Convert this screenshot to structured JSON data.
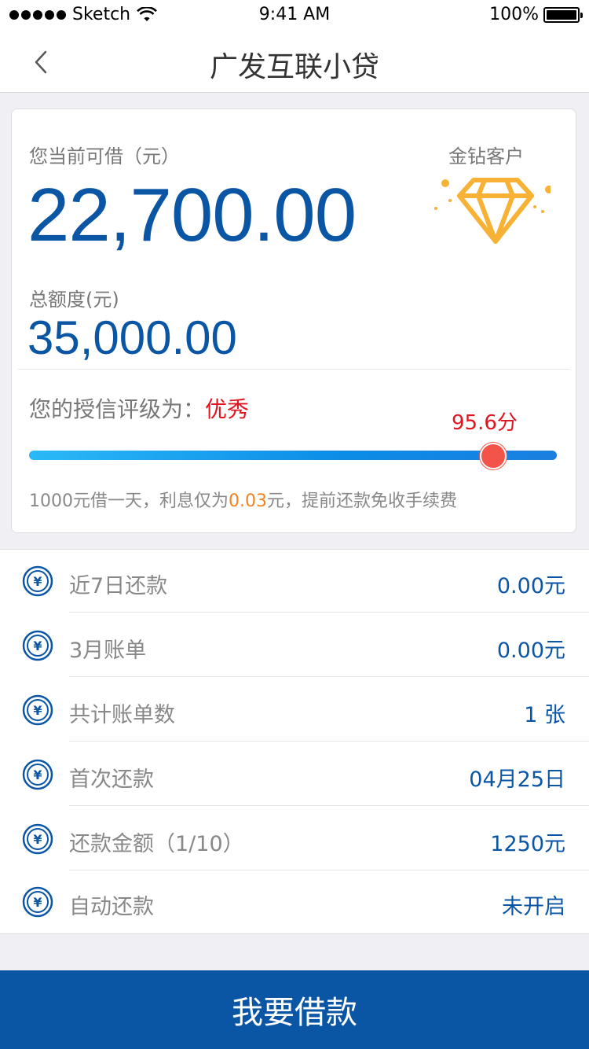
{
  "status_bar": {
    "carrier": "Sketch",
    "time": "9:41 AM",
    "battery": "100%"
  },
  "nav": {
    "title": "广发互联小贷",
    "back_icon": "chevron-left-icon"
  },
  "card": {
    "available_label": "您当前可借（元）",
    "available_amount": "22,700.00",
    "vip_label": "金钻客户",
    "vip_icon": "diamond-icon",
    "total_label": "总额度(元)",
    "total_amount": "35,000.00",
    "rating_label": "您的授信评级为：",
    "rating_value": "优秀",
    "score_text": "95.6分",
    "score_fraction": 0.88,
    "tip_prefix": "1000元借一天，利息仅为",
    "tip_rate": "0.03",
    "tip_suffix": "元，提前还款免收手续费"
  },
  "list": {
    "items": [
      {
        "label": "近7日还款",
        "value": "0.00元",
        "icon": "yen-icon"
      },
      {
        "label": "3月账单",
        "value": "0.00元",
        "icon": "yen-icon"
      },
      {
        "label": "共计账单数",
        "value": "1 张",
        "icon": "yen-icon"
      },
      {
        "label": "首次还款",
        "value": "04月25日",
        "icon": "yen-icon"
      },
      {
        "label": "还款金额（1/10）",
        "value": "1250元",
        "icon": "yen-icon"
      },
      {
        "label": "自动还款",
        "value": "未开启",
        "icon": "yen-icon"
      }
    ]
  },
  "bottom": {
    "borrow_label": "我要借款"
  },
  "colors": {
    "primary": "#0a56a5",
    "danger": "#e0141e",
    "accent": "#f5821f",
    "diamond": "#f7b134"
  }
}
